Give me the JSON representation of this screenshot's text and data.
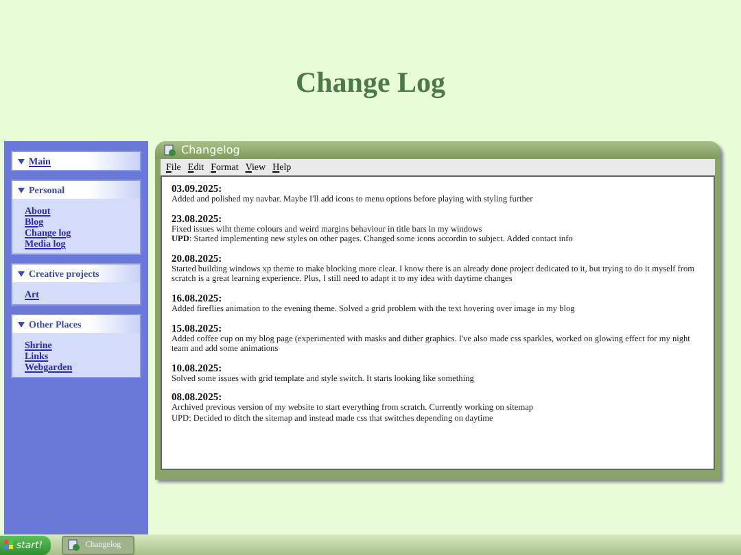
{
  "page_title": "Change Log",
  "sidebar": {
    "groups": [
      {
        "title": "Main",
        "kind": "link"
      },
      {
        "title": "Personal",
        "kind": "heading",
        "items": [
          "About",
          "Blog",
          "Change log",
          "Media log"
        ]
      },
      {
        "title": "Creative projects",
        "kind": "heading",
        "items": [
          "Art"
        ]
      },
      {
        "title": "Other Places",
        "kind": "heading",
        "items": [
          "Shrine",
          "Links",
          "Webgarden"
        ]
      }
    ]
  },
  "window": {
    "title": "Changelog",
    "menu": [
      "File",
      "Edit",
      "Format",
      "View",
      "Help"
    ],
    "entries": [
      {
        "date": "03.09.2025:",
        "lines": [
          "Added and polished my navbar. Maybe I'll add icons to menu options before playing with styling further"
        ]
      },
      {
        "date": "23.08.2025:",
        "lines": [
          "Fixed issues wiht theme colours and weird margins behaviour in title bars in my windows",
          "**UPD**: Started implementing new styles on other pages. Changed some icons accordin to subject. Added contact info"
        ]
      },
      {
        "date": "20.08.2025:",
        "lines": [
          "Started building windows xp theme to make blocking more clear. I know there is an already done project dedicated to it, but trying to do it myself from scratch is a great learning experience. Plus, I still need to adapt it to my idea with daytime changes"
        ]
      },
      {
        "date": "16.08.2025:",
        "lines": [
          "Added fireflies animation to the evening theme. Solved a grid problem with the text hovering over image in my blog"
        ]
      },
      {
        "date": "15.08.2025:",
        "lines": [
          "Added coffee cup on my blog page (experimented with masks and dither graphics. I've also made css sparkles, worked on glowing effect for my night team and add some animations"
        ]
      },
      {
        "date": "10.08.2025:",
        "lines": [
          "Solved some issues with grid template and style switch. It starts looking like something"
        ]
      },
      {
        "date": "08.08.2025:",
        "lines": [
          "Archived previous version of my website to start everything from scratch. Currently working on sitemap",
          "UPD: Decided to ditch the sitemap and instead made css that switches depending on daytime"
        ]
      }
    ]
  },
  "taskbar": {
    "start": "start!",
    "tasks": [
      "Changelog"
    ]
  }
}
